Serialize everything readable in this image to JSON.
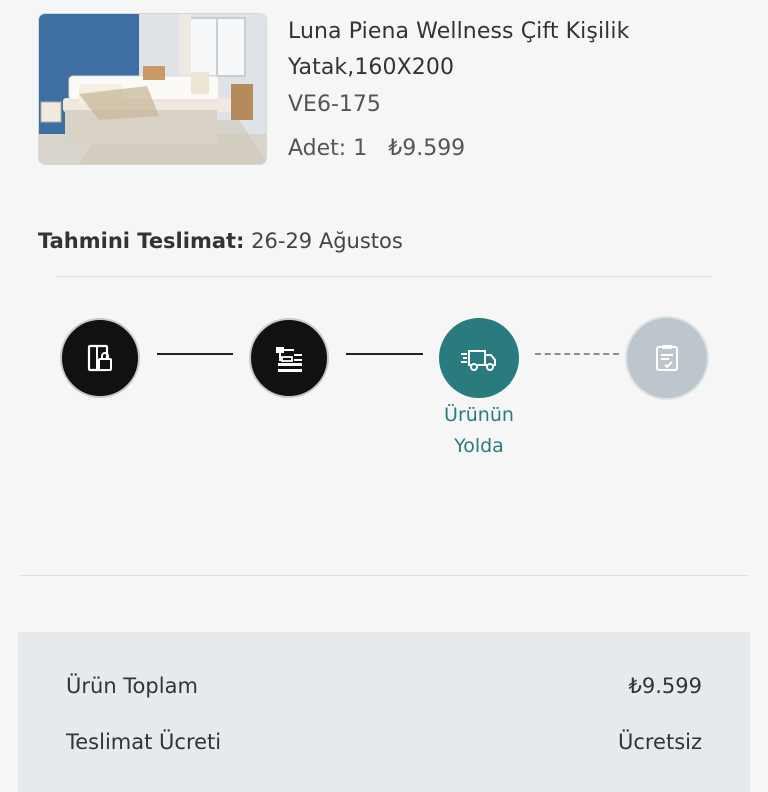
{
  "product": {
    "title": "Luna Piena Wellness Çift Kişilik Yatak,160X200",
    "sku": "VE6-175",
    "qty_label": "Adet: 1",
    "price": "₺9.599"
  },
  "delivery": {
    "label": "Tahmini Teslimat:",
    "dates": "26-29 Ağustos"
  },
  "tracking": {
    "steps": [
      {
        "icon": "order-box-icon",
        "state": "done"
      },
      {
        "icon": "assembly-icon",
        "state": "done"
      },
      {
        "icon": "delivery-truck-icon",
        "state": "current",
        "label_line1": "Ürünün",
        "label_line2": "Yolda"
      },
      {
        "icon": "checklist-icon",
        "state": "pending"
      }
    ]
  },
  "summary": {
    "product_total_label": "Ürün Toplam",
    "product_total_value": "₺9.599",
    "shipping_label": "Teslimat Ücreti",
    "shipping_value": "Ücretsiz"
  },
  "colors": {
    "accent": "#2a7b7d",
    "done": "#111111",
    "pending": "#bcc6cc",
    "summary_bg": "#e7eaec"
  }
}
